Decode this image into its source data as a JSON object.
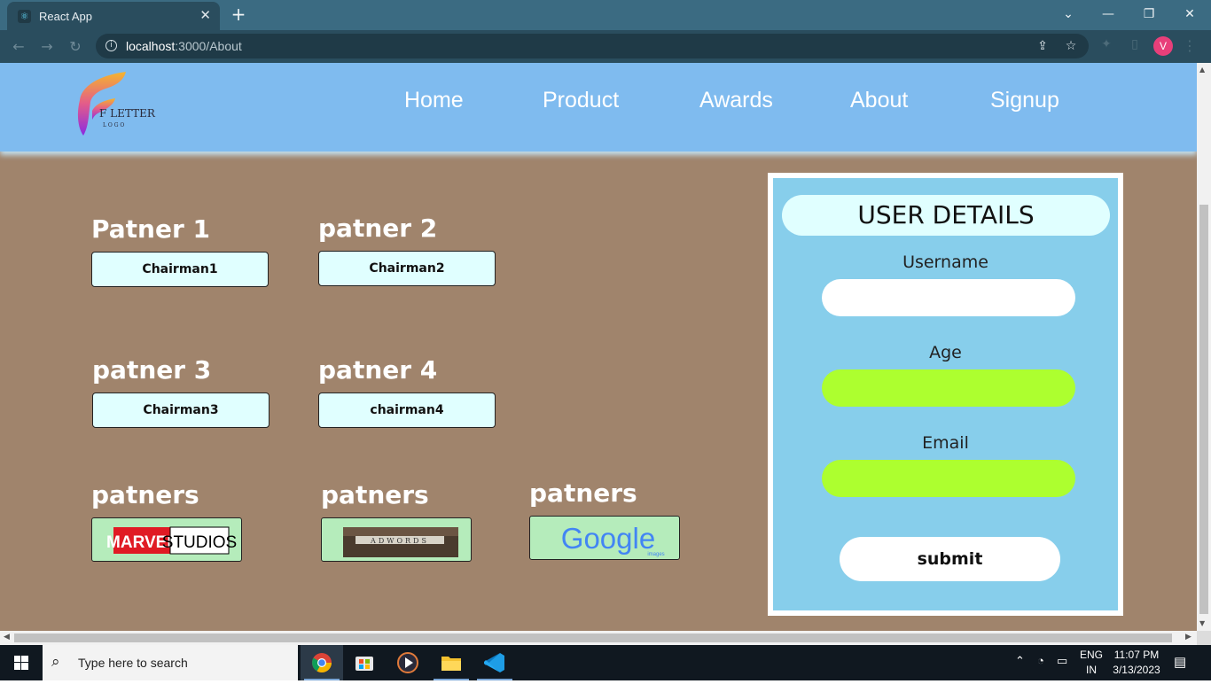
{
  "browser": {
    "tab_title": "React App",
    "tab_close": "✕",
    "new_tab": "+",
    "url_host": "localhost",
    "url_rest": ":3000/About",
    "profile_initial": "V",
    "window_controls": {
      "minimize": "—",
      "restore": "❐",
      "close": "✕",
      "tabsearch": "⌄"
    }
  },
  "site": {
    "logo_text": "F LETTER",
    "logo_subtext": "L O G O",
    "nav": [
      "Home",
      "Product",
      "Awards",
      "About",
      "Signup"
    ]
  },
  "partners": [
    {
      "title": "Patner 1",
      "button": "Chairman1"
    },
    {
      "title": "patner 2",
      "button": "Chairman2"
    },
    {
      "title": "patner 3",
      "button": "Chairman3"
    },
    {
      "title": "patner 4",
      "button": "chairman4"
    }
  ],
  "partner_logos": [
    {
      "title": "patners",
      "logo": "MARVEL STUDIOS",
      "logo_left": "MARVEL",
      "logo_right": "STUDIOS"
    },
    {
      "title": "patners",
      "logo": "ADWORDS",
      "logo_text": "ADWORDS"
    },
    {
      "title": "patners",
      "logo": "Google images",
      "logo_text": "Google",
      "logo_sub": "images"
    }
  ],
  "form": {
    "title": "USER DETAILS",
    "username_label": "Username",
    "username_value": "",
    "age_label": "Age",
    "age_value": "",
    "email_label": "Email",
    "email_value": "",
    "submit_label": "submit",
    "colors": {
      "username_bg": "#ffffff",
      "age_bg": "#adff2f",
      "email_bg": "#adff2f"
    }
  },
  "taskbar": {
    "search_placeholder": "Type here to search",
    "lang_line1": "ENG",
    "lang_line2": "IN",
    "time": "11:07 PM",
    "date": "3/13/2023",
    "apps": [
      "chrome-icon",
      "store-icon",
      "media-player-icon",
      "file-explorer-icon",
      "vscode-icon"
    ]
  },
  "colors": {
    "tab_bar": "#3b6b82",
    "page_bg": "#a0846c",
    "nav_bg": "#7fbbef",
    "form_bg": "#87ceeb",
    "button_bg": "#e0ffff",
    "logo_box_bg": "#b5ecbb"
  }
}
